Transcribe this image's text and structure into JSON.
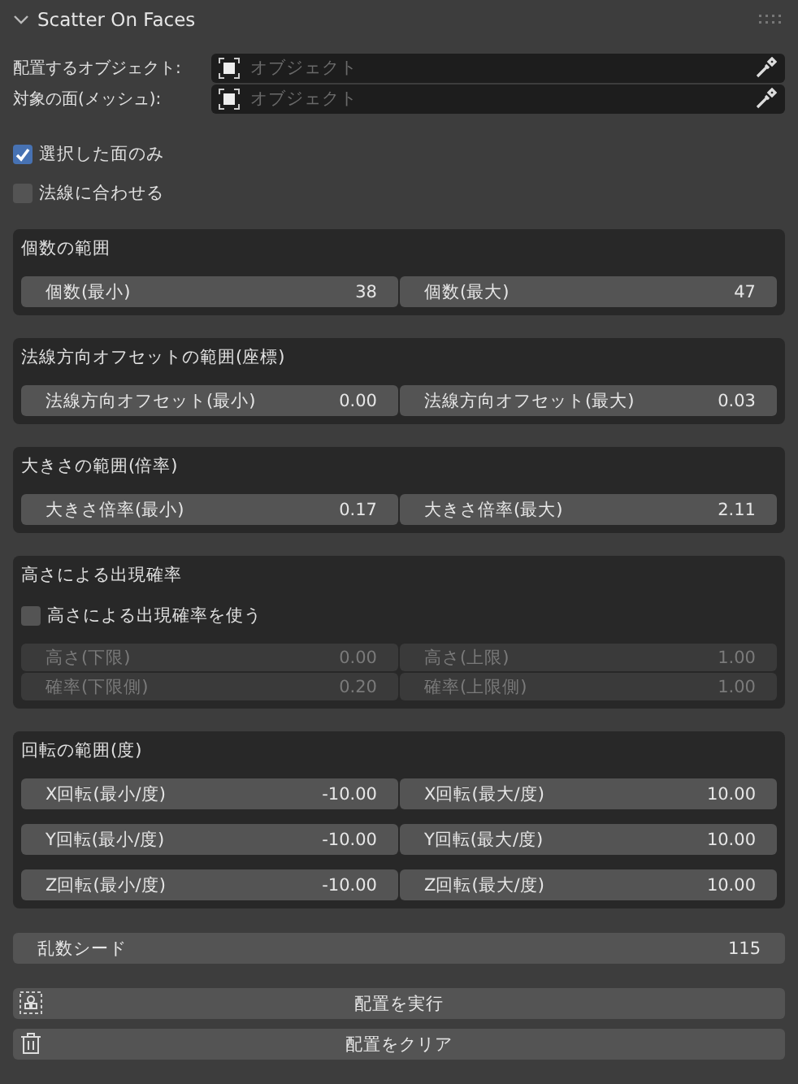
{
  "panel": {
    "title": "Scatter On Faces",
    "expanded": true
  },
  "object_fields": [
    {
      "label": "配置するオブジェクト:",
      "placeholder": "オブジェクト"
    },
    {
      "label": "対象の面(メッシュ):",
      "placeholder": "オブジェクト"
    }
  ],
  "checkboxes": [
    {
      "label": "選択した面のみ",
      "checked": true
    },
    {
      "label": "法線に合わせる",
      "checked": false
    }
  ],
  "sections": [
    {
      "title": "個数の範囲",
      "disabled": false,
      "rows": [
        [
          {
            "label": "個数(最小)",
            "value": "38"
          },
          {
            "label": "個数(最大)",
            "value": "47"
          }
        ]
      ]
    },
    {
      "title": "法線方向オフセットの範囲(座標)",
      "disabled": false,
      "rows": [
        [
          {
            "label": "法線方向オフセット(最小)",
            "value": "0.00"
          },
          {
            "label": "法線方向オフセット(最大)",
            "value": "0.03"
          }
        ]
      ]
    },
    {
      "title": "大きさの範囲(倍率)",
      "disabled": false,
      "rows": [
        [
          {
            "label": "大きさ倍率(最小)",
            "value": "0.17"
          },
          {
            "label": "大きさ倍率(最大)",
            "value": "2.11"
          }
        ]
      ]
    },
    {
      "title": "高さによる出現確率",
      "toggle": {
        "label": "高さによる出現確率を使う",
        "checked": false
      },
      "disabled": true,
      "rows": [
        [
          {
            "label": "高さ(下限)",
            "value": "0.00"
          },
          {
            "label": "高さ(上限)",
            "value": "1.00"
          }
        ],
        [
          {
            "label": "確率(下限側)",
            "value": "0.20"
          },
          {
            "label": "確率(上限側)",
            "value": "1.00"
          }
        ]
      ]
    },
    {
      "title": "回転の範囲(度)",
      "disabled": false,
      "rows": [
        [
          {
            "label": "X回転(最小/度)",
            "value": "-10.00"
          },
          {
            "label": "X回転(最大/度)",
            "value": "10.00"
          }
        ],
        [
          {
            "label": "Y回転(最小/度)",
            "value": "-10.00"
          },
          {
            "label": "Y回転(最大/度)",
            "value": "10.00"
          }
        ],
        [
          {
            "label": "Z回転(最小/度)",
            "value": "-10.00"
          },
          {
            "label": "Z回転(最大/度)",
            "value": "10.00"
          }
        ]
      ]
    }
  ],
  "seed": {
    "label": "乱数シード",
    "value": "115"
  },
  "buttons": [
    {
      "label": "配置を実行",
      "kind": "run"
    },
    {
      "label": "配置をクリア",
      "kind": "clear"
    }
  ]
}
